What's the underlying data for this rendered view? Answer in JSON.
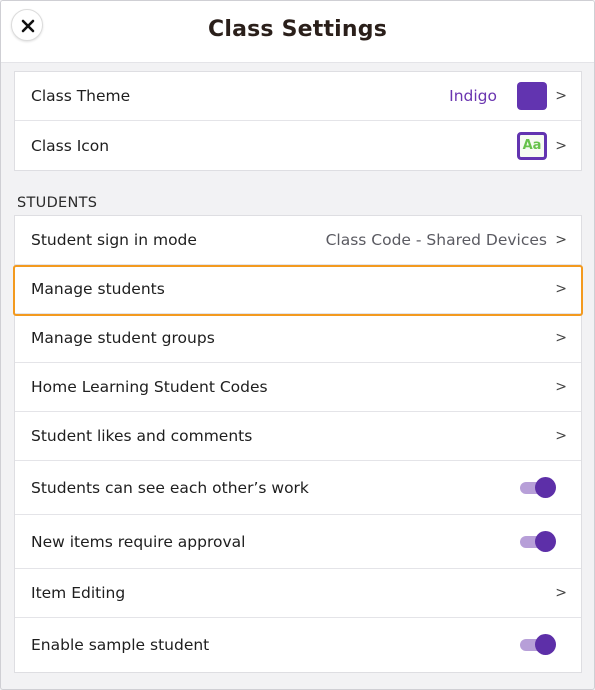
{
  "header": {
    "title": "Class Settings",
    "close_icon": "close-icon"
  },
  "appearance": {
    "items": [
      {
        "label": "Class Theme",
        "value": "Indigo",
        "swatch_color": "#6234b0",
        "chevron": ">"
      },
      {
        "label": "Class Icon",
        "icon_text": "Aa",
        "chevron": ">"
      }
    ]
  },
  "students": {
    "section_label": "STUDENTS",
    "items": [
      {
        "label": "Student sign in mode",
        "value": "Class Code - Shared Devices",
        "chevron": ">"
      },
      {
        "label": "Manage students",
        "chevron": ">",
        "highlighted": true
      },
      {
        "label": "Manage student groups",
        "chevron": ">"
      },
      {
        "label": "Home Learning Student Codes",
        "chevron": ">"
      },
      {
        "label": "Student likes and comments",
        "chevron": ">"
      },
      {
        "label": "Students can see each other’s work",
        "toggle": true
      },
      {
        "label": "New items require approval",
        "toggle": true
      },
      {
        "label": "Item Editing",
        "chevron": ">"
      },
      {
        "label": "Enable sample student",
        "toggle": true
      }
    ]
  },
  "colors": {
    "accent": "#6234b0",
    "toggle_track": "#b79fd8",
    "highlight_border": "#f39a1f"
  }
}
